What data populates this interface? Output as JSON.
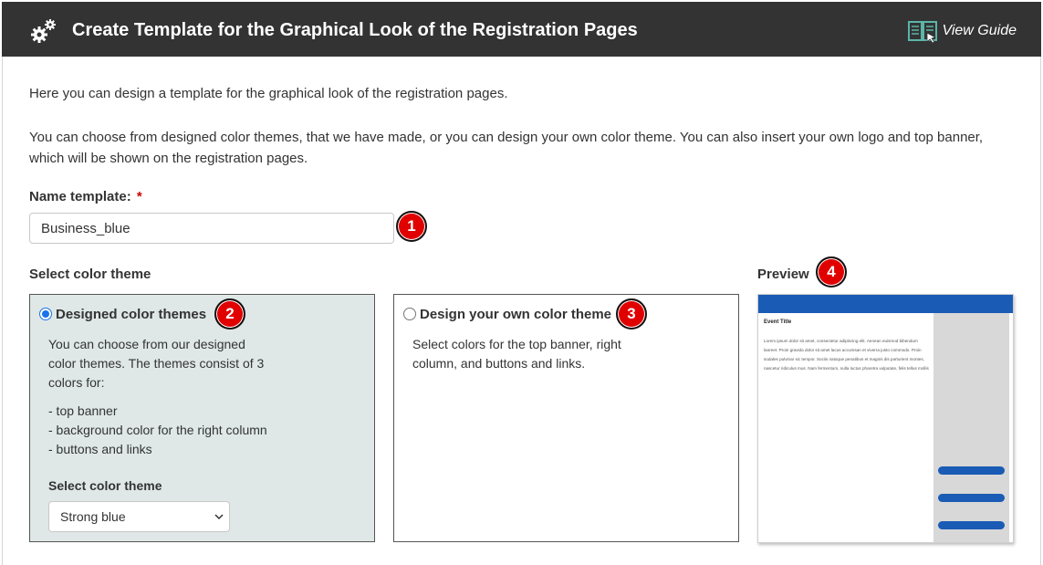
{
  "header": {
    "title": "Create Template for the Graphical Look of the Registration Pages",
    "guide_label": "View Guide",
    "gear_icon": "gears-icon",
    "guide_icon": "book-guide-icon"
  },
  "intro": {
    "line1": "Here you can design a template for the graphical look of the registration pages.",
    "line2": "You can choose from designed color themes, that we have made, or you can design your own color theme. You can also insert your own logo and top banner, which will be shown on the registration pages."
  },
  "name_field": {
    "label": "Name template:",
    "required_mark": "*",
    "value": "Business_blue"
  },
  "section_label": "Select color theme",
  "preview_label": "Preview",
  "badges": [
    "1",
    "2",
    "3",
    "4"
  ],
  "designed_panel": {
    "title": "Designed color themes",
    "selected": true,
    "description": "You can choose from our designed color themes. The themes consist of 3 colors for:",
    "list": [
      "- top banner",
      "- background color for the right column",
      "- buttons and links"
    ],
    "select_label": "Select color theme",
    "select_value": "Strong blue"
  },
  "own_panel": {
    "title": "Design your own color theme",
    "selected": false,
    "description": "Select colors for the top banner, right column, and buttons and links."
  },
  "preview": {
    "event_title": "Event Title",
    "body_text": "Lorem ipsum dolor sit amet, consectetur adipiscing elit. Aenean euismod bibendum laoreet. Proin gravida dolor sit amet lacus accumsan et viverra justo commodo. Proin sodales pulvinar sic tempor. Sociis natoque penatibus et magnis dis parturient montes, nascetur ridiculus mus. Nam fermentum, nulla luctus pharetra vulputate, felis tellus mollis",
    "banner_color": "#1a5bb5",
    "column_color": "#d8d8d8",
    "button_color": "#1a5bb5"
  },
  "colors": {
    "header_bg": "#333333",
    "selected_panel_bg": "#dfe8e7",
    "badge_red": "#e00000",
    "required_red": "#cc0000"
  }
}
